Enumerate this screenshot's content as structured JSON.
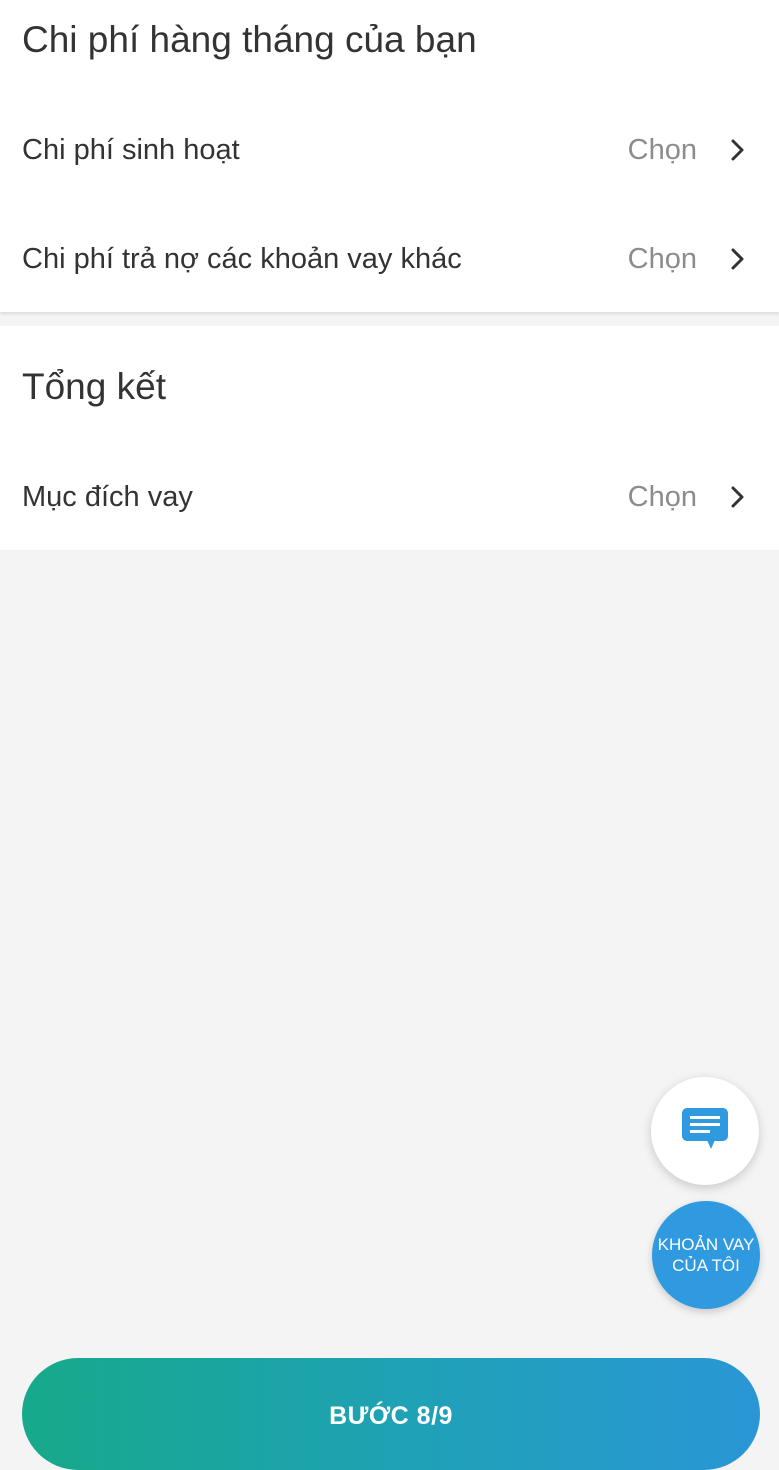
{
  "monthly_expenses": {
    "title": "Chi phí hàng tháng của bạn",
    "rows": [
      {
        "label": "Chi phí sinh hoạt",
        "value": "Chọn"
      },
      {
        "label": "Chi phí trả nợ các khoản vay khác",
        "value": "Chọn"
      }
    ]
  },
  "summary": {
    "title": "Tổng kết",
    "rows": [
      {
        "label": "Mục đích vay",
        "value": "Chọn"
      }
    ]
  },
  "fab_chat": {
    "icon": "chat-icon",
    "color": "#2f9ae0"
  },
  "fab_loans": {
    "line1": "KHOẢN VAY",
    "line2": "CỦA TÔI",
    "color": "#2f9ae0"
  },
  "step_button": {
    "label": "BƯỚC 8/9"
  },
  "colors": {
    "background": "#f4f4f4",
    "card": "#ffffff",
    "text": "#333333",
    "muted": "#8c8c8c",
    "gradient_start": "#17a98a",
    "gradient_end": "#2a96d6"
  }
}
